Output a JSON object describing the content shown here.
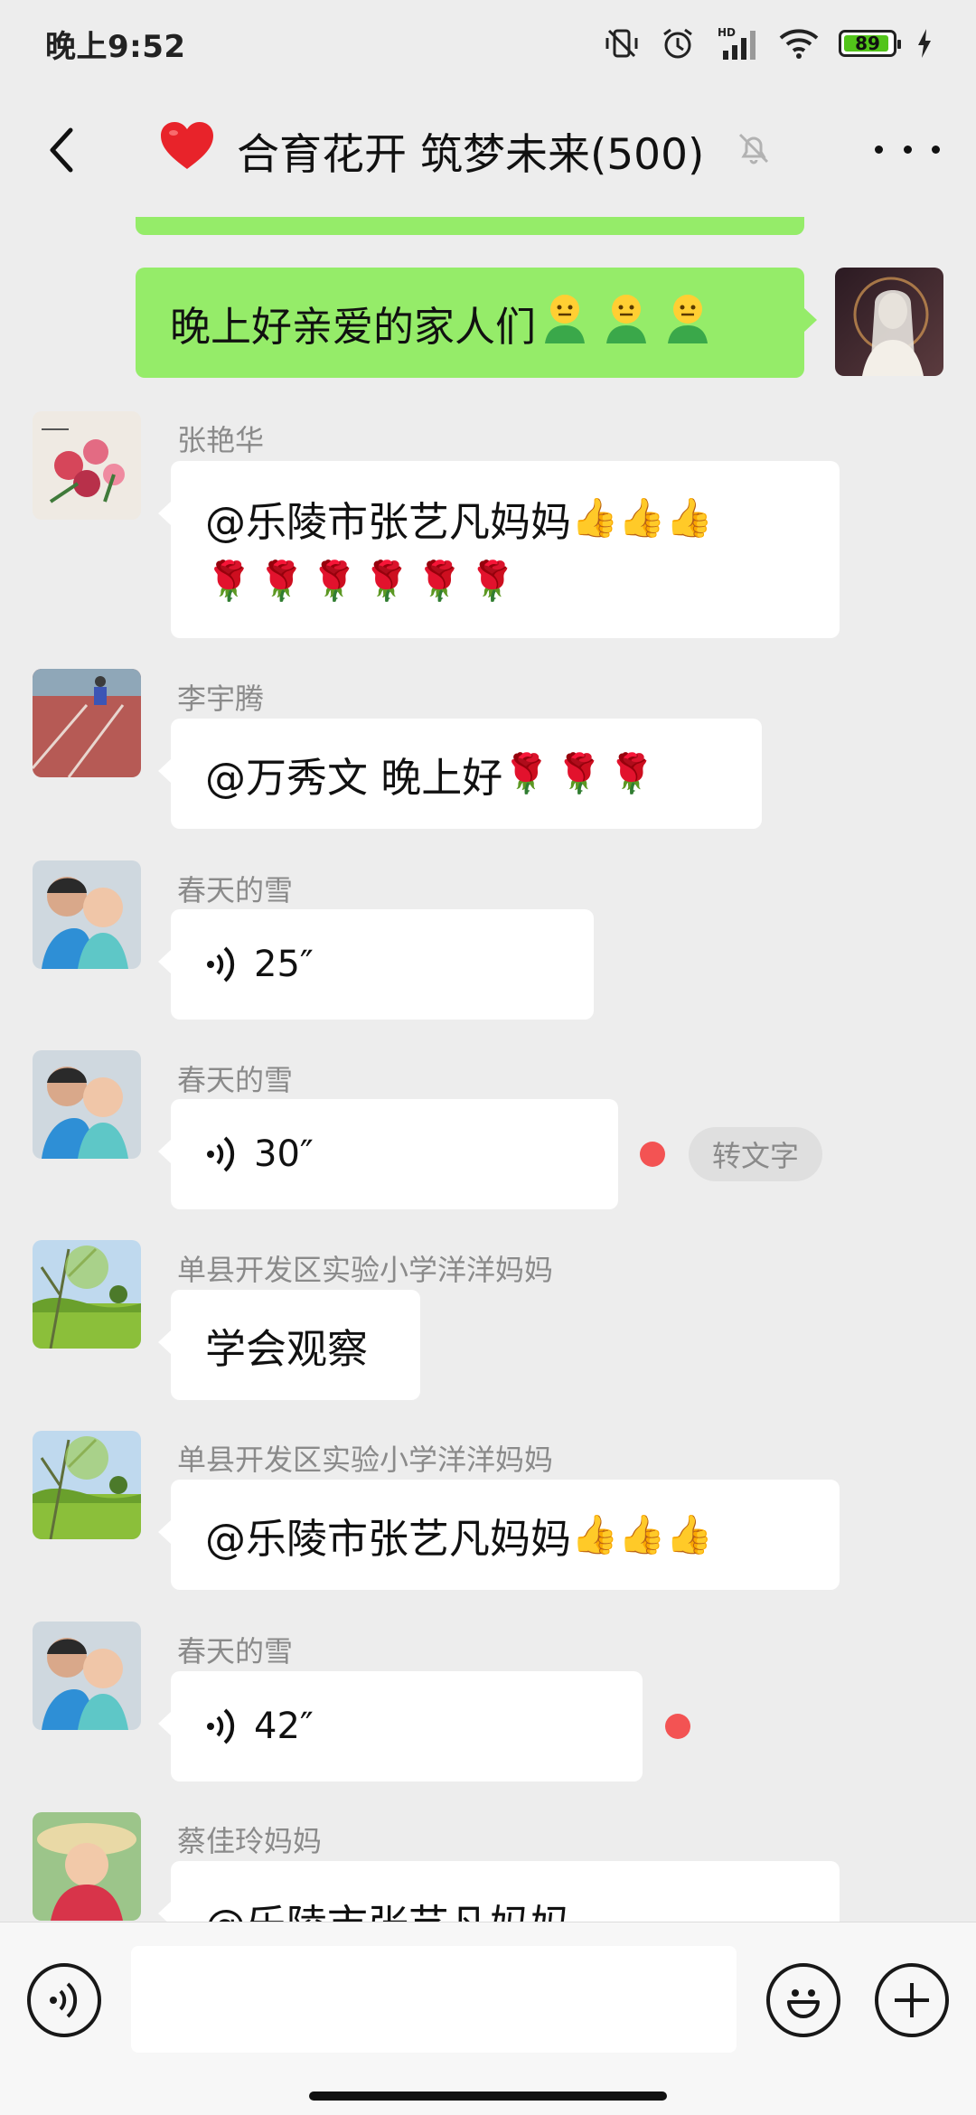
{
  "status_bar": {
    "time": "晚上9:52",
    "battery": "89",
    "network": "HD"
  },
  "header": {
    "title": "合育花开 筑梦未来(500)",
    "heart": "❤"
  },
  "messages": [
    {
      "type": "self_text",
      "text": "晚上好亲爱的家人们",
      "emoji_count": 3
    },
    {
      "type": "text",
      "sender": "张艳华",
      "line1": "@乐陵市张艺凡妈妈 ",
      "line1_emoji": "👍👍👍",
      "line2": "🌹🌹🌹🌹🌹🌹"
    },
    {
      "type": "text",
      "sender": "李宇腾",
      "text": "@万秀文  晚上好",
      "emoji": "🌹🌹🌹"
    },
    {
      "type": "voice",
      "sender": "春天的雪",
      "duration": "25″"
    },
    {
      "type": "voice",
      "sender": "春天的雪",
      "duration": "30″",
      "unread": true,
      "action": "转文字"
    },
    {
      "type": "text",
      "sender": "单县开发区实验小学洋洋妈妈",
      "text": "学会观察"
    },
    {
      "type": "text",
      "sender": "单县开发区实验小学洋洋妈妈",
      "text": "@乐陵市张艺凡妈妈 ",
      "emoji": "👍👍👍"
    },
    {
      "type": "voice",
      "sender": "春天的雪",
      "duration": "42″",
      "unread": true
    },
    {
      "type": "text",
      "sender": "蔡佳玲妈妈",
      "text": "@乐陵市张艺凡妈妈"
    }
  ],
  "input": {
    "value": "",
    "placeholder": ""
  },
  "colors": {
    "self_bubble": "#95ec69",
    "background": "#ededed",
    "unread_dot": "#f35353"
  }
}
